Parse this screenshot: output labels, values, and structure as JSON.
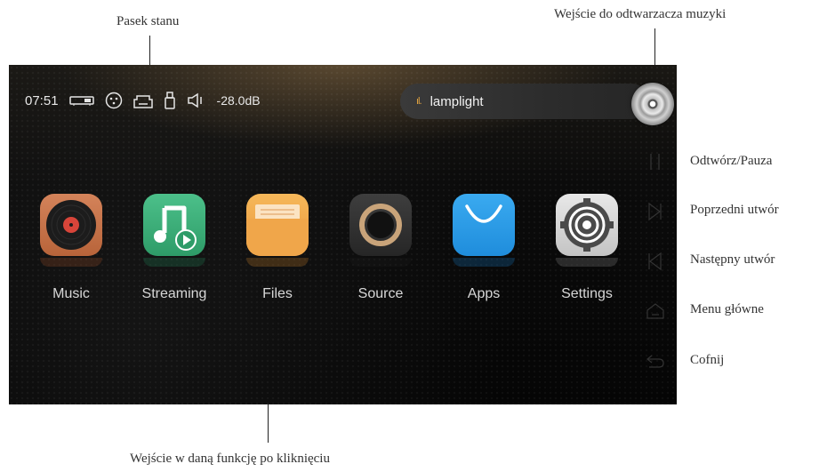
{
  "annotations": {
    "status_bar": "Pasek stanu",
    "music_player_entry": "Wejście do odtwarzacza muzyki",
    "function_entry": "Wejście w daną funkcję po kliknięciu",
    "play_pause": "Odtwórz/Pauza",
    "previous_track": "Poprzedni utwór",
    "next_track": "Następny utwór",
    "main_menu": "Menu główne",
    "back": "Cofnij"
  },
  "status": {
    "time": "07:51",
    "volume": "-28.0dB",
    "icons": [
      "dac-icon",
      "coaxial-icon",
      "network-icon",
      "usb-icon",
      "speaker-icon"
    ]
  },
  "now_playing": {
    "bars": "ıl.",
    "title": "lamplight"
  },
  "apps": [
    {
      "label": "Music",
      "icon": "vinyl-icon"
    },
    {
      "label": "Streaming",
      "icon": "streaming-note-icon"
    },
    {
      "label": "Files",
      "icon": "folder-icon"
    },
    {
      "label": "Source",
      "icon": "ring-icon"
    },
    {
      "label": "Apps",
      "icon": "bag-icon"
    },
    {
      "label": "Settings",
      "icon": "gear-icon"
    }
  ],
  "colors": {
    "accent": "#e2a441",
    "music_tile": "#c9784a",
    "streaming_tile": "#3fae7a",
    "files_tile": "#f0a64a",
    "source_tile": "#333333",
    "apps_tile": "#2a9de8",
    "settings_tile": "#d9d9d9"
  }
}
